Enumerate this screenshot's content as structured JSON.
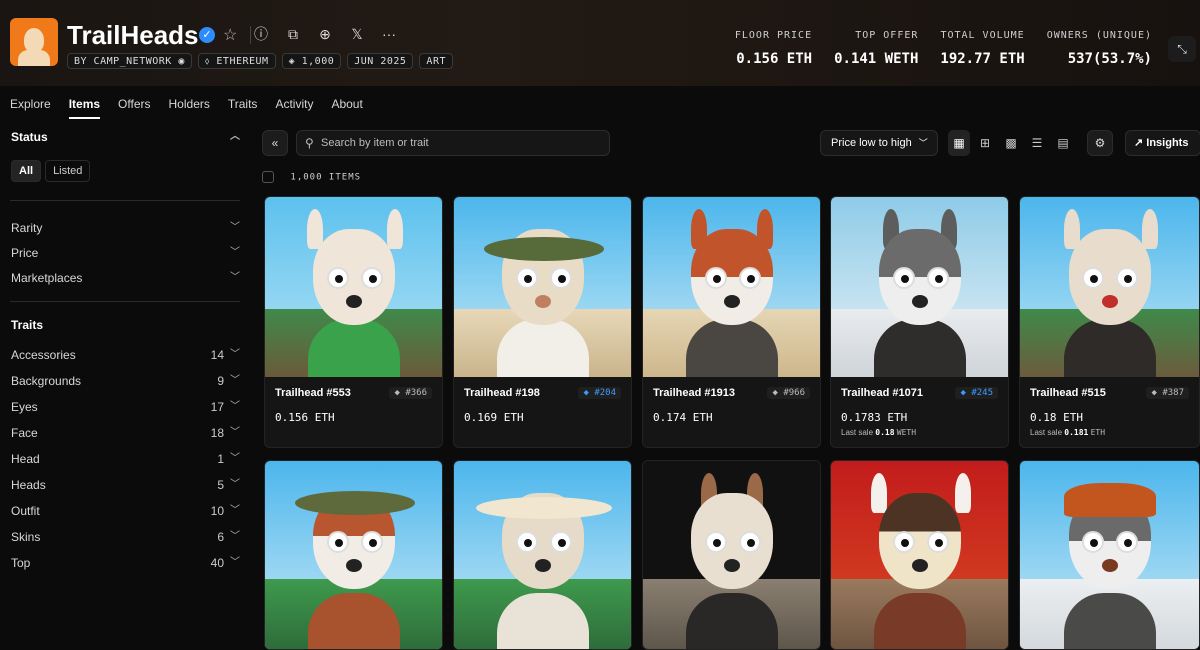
{
  "collection": {
    "title": "TrailHeads",
    "chips": [
      "BY CAMP_NETWORK",
      "ETHEREUM",
      "1,000",
      "JUN 2025",
      "ART"
    ]
  },
  "stats": [
    {
      "label": "FLOOR PRICE",
      "value": "0.156 ETH"
    },
    {
      "label": "TOP OFFER",
      "value": "0.141 WETH"
    },
    {
      "label": "TOTAL VOLUME",
      "value": "192.77 ETH"
    },
    {
      "label": "OWNERS (UNIQUE)",
      "value": "537(53.7%)"
    }
  ],
  "tabs": [
    "Explore",
    "Items",
    "Offers",
    "Holders",
    "Traits",
    "Activity",
    "About"
  ],
  "sidebar": {
    "status_title": "Status",
    "status_options": [
      "All",
      "Listed"
    ],
    "filters": [
      "Rarity",
      "Price",
      "Marketplaces"
    ],
    "traits_title": "Traits",
    "traits": [
      {
        "name": "Accessories",
        "count": "14"
      },
      {
        "name": "Backgrounds",
        "count": "9"
      },
      {
        "name": "Eyes",
        "count": "17"
      },
      {
        "name": "Face",
        "count": "18"
      },
      {
        "name": "Head",
        "count": "1"
      },
      {
        "name": "Heads",
        "count": "5"
      },
      {
        "name": "Outfit",
        "count": "10"
      },
      {
        "name": "Skins",
        "count": "6"
      },
      {
        "name": "Top",
        "count": "40"
      }
    ]
  },
  "toolbar": {
    "search_placeholder": "Search by item or trait",
    "sort_label": "Price low to high",
    "insights_label": "Insights",
    "item_count": "1,000 ITEMS"
  },
  "items": [
    {
      "name": "Trailhead #553",
      "rank": "#366",
      "rank_color": "gray",
      "price": "0.156 ETH",
      "last": ""
    },
    {
      "name": "Trailhead #198",
      "rank": "#204",
      "rank_color": "blue",
      "price": "0.169 ETH",
      "last": ""
    },
    {
      "name": "Trailhead #1913",
      "rank": "#966",
      "rank_color": "gray",
      "price": "0.174 ETH",
      "last": ""
    },
    {
      "name": "Trailhead #1071",
      "rank": "#245",
      "rank_color": "blue",
      "price": "0.1783 ETH",
      "last_label": "Last sale",
      "last_value": "0.18",
      "last_unit": "WETH"
    },
    {
      "name": "Trailhead #515",
      "rank": "#387",
      "rank_color": "gray",
      "price": "0.18 ETH",
      "last_label": "Last sale",
      "last_value": "0.181",
      "last_unit": "ETH"
    }
  ],
  "colors": {
    "accent_blue": "#3a9bff",
    "logo_orange": "#f07a1a",
    "background": "#0b0b0b"
  }
}
